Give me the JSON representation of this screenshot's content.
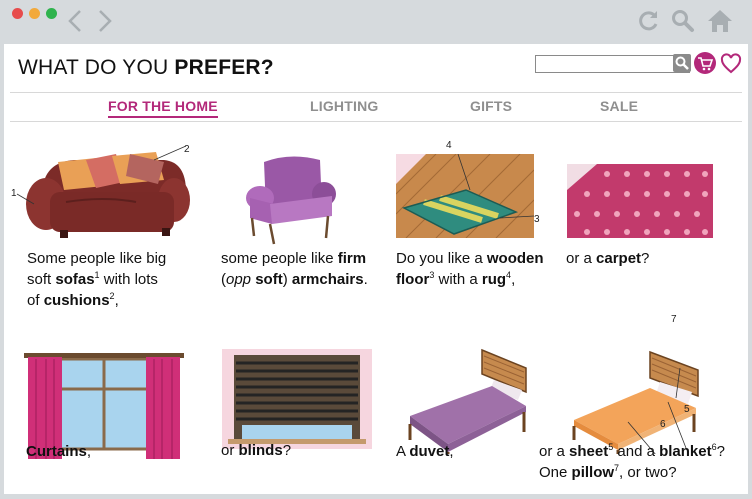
{
  "window": {
    "colors": {
      "close": "#e74c4c",
      "minimize": "#f2a93b",
      "maximize": "#2fb34d",
      "chrome": "#d6dadd",
      "accent": "#b3287a"
    }
  },
  "header": {
    "title_plain": "WHAT DO YOU ",
    "title_bold": "PREFER?"
  },
  "nav": {
    "items": [
      "FOR THE HOME",
      "LIGHTING",
      "GIFTS",
      "SALE"
    ],
    "active": "FOR THE HOME"
  },
  "icons": [
    "back-arrow-icon",
    "forward-arrow-icon",
    "reload-icon",
    "search-icon",
    "home-icon",
    "cart-icon",
    "heart-icon"
  ],
  "items": [
    {
      "id": "sofa",
      "caption": [
        {
          "t": "Some people like big"
        },
        {
          "br": true
        },
        {
          "t": "soft "
        },
        {
          "b": "sofas"
        },
        {
          "sup": "1"
        },
        {
          "t": " with lots"
        },
        {
          "br": true
        },
        {
          "t": "of "
        },
        {
          "b": "cushions"
        },
        {
          "sup": "2"
        },
        {
          "t": ","
        }
      ],
      "numbers": [
        "1",
        "2"
      ]
    },
    {
      "id": "armchair",
      "caption": [
        {
          "t": "some people like "
        },
        {
          "b": "firm"
        },
        {
          "br": true
        },
        {
          "t": "("
        },
        {
          "i": "opp"
        },
        {
          "t": " "
        },
        {
          "b": "soft"
        },
        {
          "t": ") "
        },
        {
          "b": "armchairs"
        },
        {
          "t": "."
        }
      ]
    },
    {
      "id": "floor",
      "caption": [
        {
          "t": "Do you like a "
        },
        {
          "b": "wooden"
        },
        {
          "br": true
        },
        {
          "b": "floor"
        },
        {
          "sup": "3"
        },
        {
          "t": " with a "
        },
        {
          "b": "rug"
        },
        {
          "sup": "4"
        },
        {
          "t": ","
        }
      ],
      "numbers": [
        "4",
        "3"
      ]
    },
    {
      "id": "carpet",
      "caption": [
        {
          "t": "or a "
        },
        {
          "b": "carpet"
        },
        {
          "t": "?"
        }
      ]
    },
    {
      "id": "curtains",
      "caption": [
        {
          "b": "Curtains"
        },
        {
          "t": ","
        }
      ]
    },
    {
      "id": "blinds",
      "caption": [
        {
          "t": "or "
        },
        {
          "b": "blinds"
        },
        {
          "t": "?"
        }
      ]
    },
    {
      "id": "duvet",
      "caption": [
        {
          "t": "A "
        },
        {
          "b": "duvet"
        },
        {
          "t": ","
        }
      ]
    },
    {
      "id": "bed",
      "caption": [
        {
          "t": "or a "
        },
        {
          "b": "sheet"
        },
        {
          "sup": "5"
        },
        {
          "t": " and a "
        },
        {
          "b": "blanket"
        },
        {
          "sup": "6"
        },
        {
          "t": "?"
        },
        {
          "br": true
        },
        {
          "t": "One "
        },
        {
          "b": "pillow"
        },
        {
          "sup": "7"
        },
        {
          "t": ", or two?"
        }
      ],
      "numbers": [
        "7",
        "6",
        "5"
      ]
    }
  ]
}
